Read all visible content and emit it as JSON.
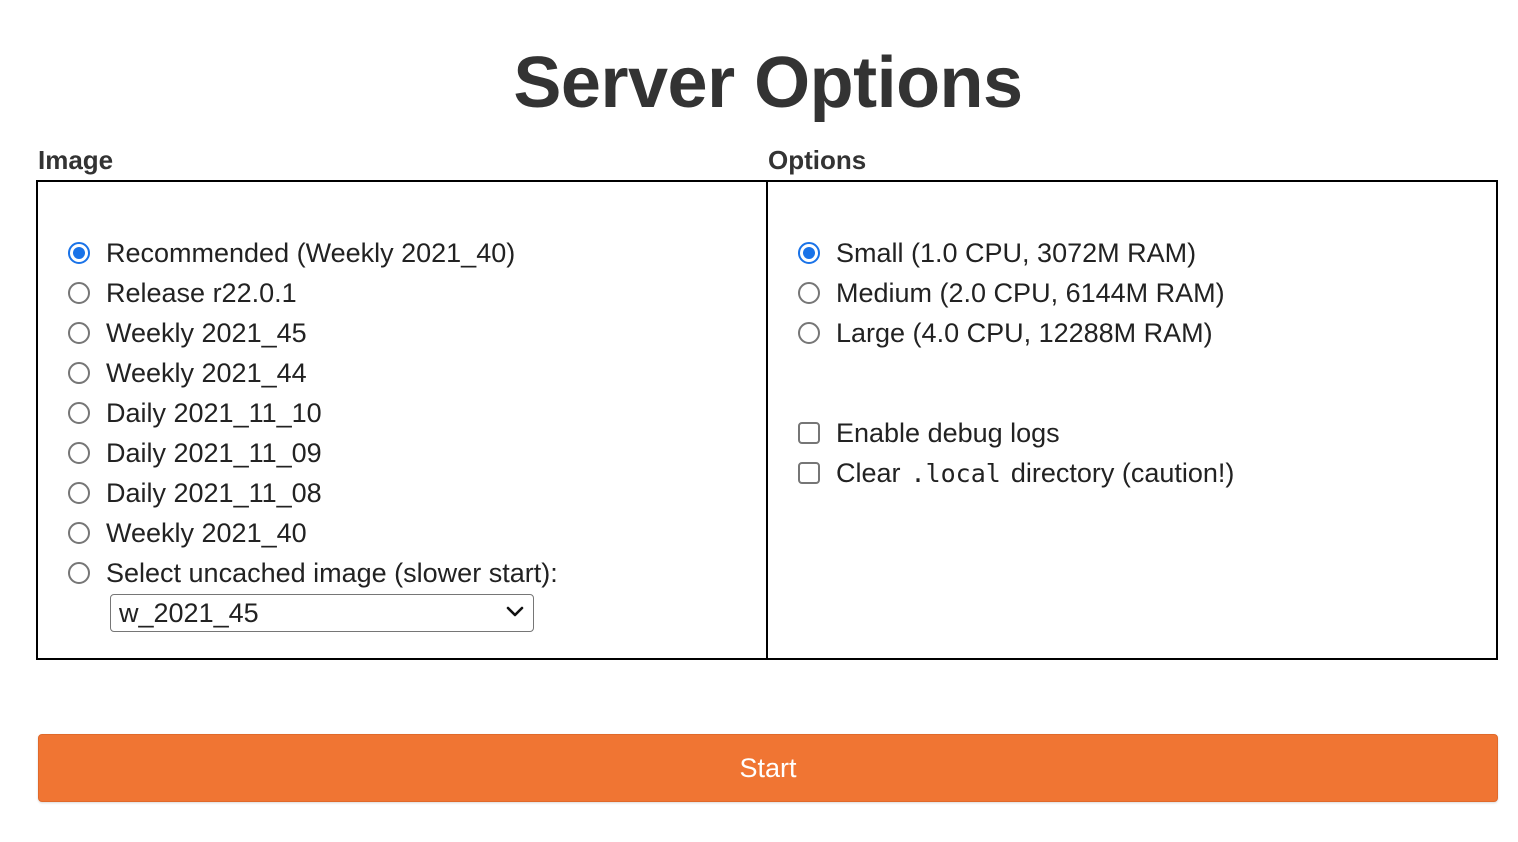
{
  "page": {
    "title": "Server Options"
  },
  "image_section": {
    "heading": "Image",
    "options": [
      {
        "label": "Recommended (Weekly 2021_40)",
        "checked": true
      },
      {
        "label": "Release r22.0.1",
        "checked": false
      },
      {
        "label": "Weekly 2021_45",
        "checked": false
      },
      {
        "label": "Weekly 2021_44",
        "checked": false
      },
      {
        "label": "Daily 2021_11_10",
        "checked": false
      },
      {
        "label": "Daily 2021_11_09",
        "checked": false
      },
      {
        "label": "Daily 2021_11_08",
        "checked": false
      },
      {
        "label": "Weekly 2021_40",
        "checked": false
      },
      {
        "label": "Select uncached image (slower start):",
        "checked": false
      }
    ],
    "uncached_select": {
      "value": "w_2021_45"
    }
  },
  "options_section": {
    "heading": "Options",
    "sizes": [
      {
        "label": "Small (1.0 CPU, 3072M RAM)",
        "checked": true
      },
      {
        "label": "Medium (2.0 CPU, 6144M RAM)",
        "checked": false
      },
      {
        "label": "Large (4.0 CPU, 12288M RAM)",
        "checked": false
      }
    ],
    "debug_logs": {
      "label": "Enable debug logs",
      "checked": false
    },
    "clear_local": {
      "label_before": "Clear",
      "code": ".local",
      "label_after": "directory (caution!)",
      "checked": false
    }
  },
  "start_button": {
    "label": "Start"
  },
  "colors": {
    "accent_radio": "#1a73e8",
    "start_button": "#f07533",
    "text": "#333333"
  },
  "icons": {
    "select_chevron": "chevron-down-icon"
  }
}
